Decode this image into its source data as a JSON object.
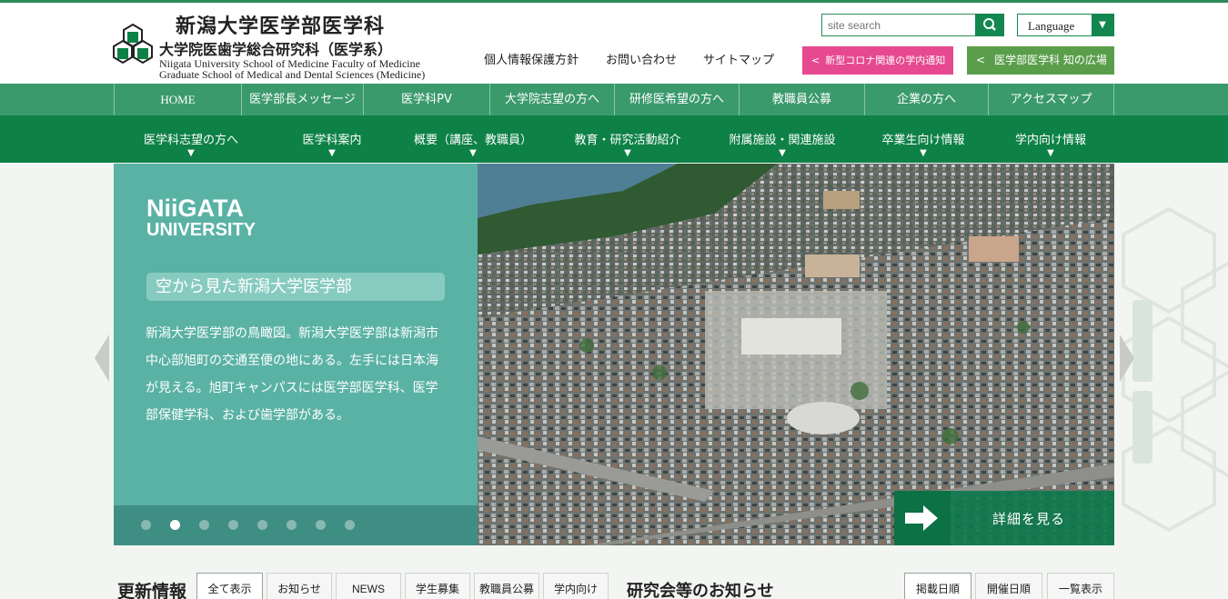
{
  "header": {
    "title_ja": "新潟大学医学部医学科",
    "title_grad": "大学院医歯学総合研究科（医学系）",
    "title_en_1": "Niigata University School of Medicine Faculty of Medicine",
    "title_en_2": "Graduate School of Medical and Dental Sciences (Medicine)",
    "search_placeholder": "site search",
    "language_label": "Language",
    "util_links": [
      "個人情報保護方針",
      "お問い合わせ",
      "サイトマップ"
    ],
    "corona_button": "新型コロナ関連の学内通知",
    "plaza_button": "医学部医学科 知の広場",
    "chevron": "<"
  },
  "nav_primary": [
    "HOME",
    "医学部長メッセージ",
    "医学科PV",
    "大学院志望の方へ",
    "研修医希望の方へ",
    "教職員公募",
    "企業の方へ",
    "アクセスマップ"
  ],
  "nav_secondary": [
    "医学科志望の方へ",
    "医学科案内",
    "概要（講座、教職員）",
    "教育・研究活動紹介",
    "附属施設・関連施設",
    "卒業生向け情報",
    "学内向け情報"
  ],
  "nav_arrow": "▼",
  "hero": {
    "logo_line1": "NiiGATA",
    "logo_line2": "UNIVERSITY",
    "tag": "空から見た新潟大学医学部",
    "description": "新潟大学医学部の鳥瞰図。新潟大学医学部は新潟市中心部旭町の交通至便の地にある。左手には日本海が見える。旭町キャンパスには医学部医学科、医学部保健学科、および歯学部がある。",
    "slide_count": 8,
    "active_slide_index": 1,
    "details_label": "詳細を見る",
    "image_alt": "aerial-photo-of-campus"
  },
  "bottom": {
    "news_title": "更新情報",
    "news_tabs": [
      "全て表示",
      "お知らせ",
      "NEWS",
      "学生募集",
      "教職員公募",
      "学内向け"
    ],
    "seminar_title": "研究会等のお知らせ",
    "seminar_tabs": [
      "掲載日順",
      "開催日順",
      "一覧表示"
    ]
  },
  "colors": {
    "brand_green": "#0d8146",
    "nav_green": "#3b9a6c",
    "teal_panel": "#5ab2a5",
    "corona_pink": "#e6498f",
    "plaza_green": "#5a9e4b"
  }
}
